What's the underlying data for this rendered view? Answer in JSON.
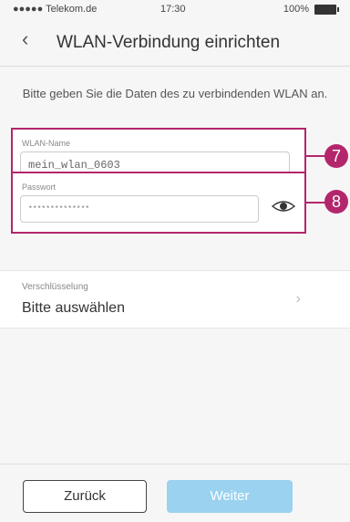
{
  "status": {
    "carrier": "●●●●● Telekom.de",
    "time": "17:30",
    "battery": "100%"
  },
  "nav": {
    "back_icon": "chevron-left-icon",
    "title": "WLAN-Verbindung einrichten"
  },
  "intro_text": "Bitte geben Sie die Daten des zu verbindenden WLAN an.",
  "wlan_name": {
    "label": "WLAN-Name",
    "value": "mein_wlan_0603"
  },
  "password": {
    "label": "Passwort",
    "value": "**************",
    "icon": "eye-icon"
  },
  "encryption": {
    "label": "Verschlüsselung",
    "value": "Bitte auswählen"
  },
  "callouts": {
    "first": "7",
    "second": "8",
    "color": "#b3266c"
  },
  "footer": {
    "back_label": "Zurück",
    "next_label": "Weiter"
  },
  "colors": {
    "accent": "#b3266c",
    "button_disabled": "#9ad2ef"
  }
}
